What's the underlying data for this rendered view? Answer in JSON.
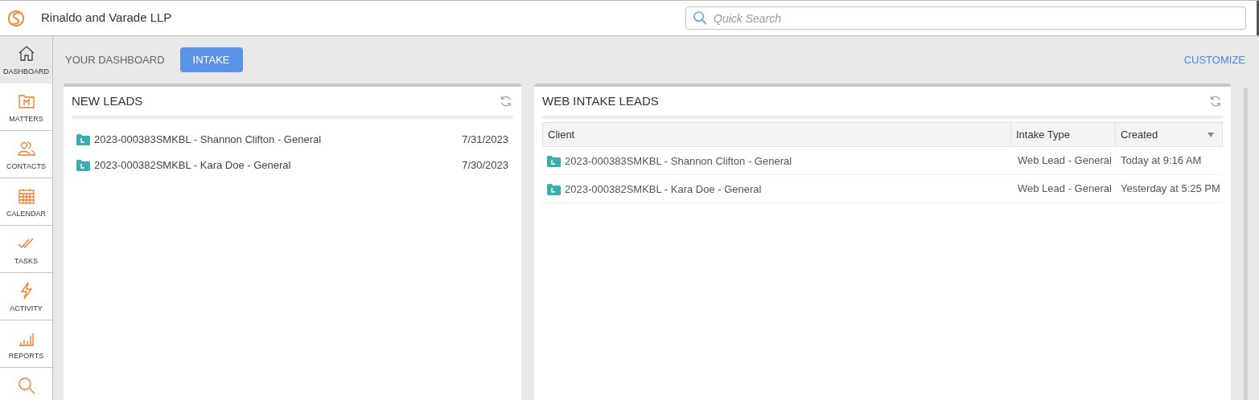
{
  "header": {
    "title": "Rinaldo and Varade LLP",
    "search": {
      "placeholder": "Quick Search"
    }
  },
  "sidebar": {
    "items": [
      {
        "kind": "dashboard",
        "label": "DASHBOARD",
        "selected": true
      },
      {
        "kind": "matters",
        "label": "MATTERS",
        "selected": false
      },
      {
        "kind": "contacts",
        "label": "CONTACTS",
        "selected": false
      },
      {
        "kind": "calendar",
        "label": "CALENDAR",
        "selected": false
      },
      {
        "kind": "tasks",
        "label": "TASKS",
        "selected": false
      },
      {
        "kind": "activity",
        "label": "ACTIVITY",
        "selected": false
      },
      {
        "kind": "reports",
        "label": "REPORTS",
        "selected": false
      },
      {
        "kind": "search",
        "selected": false
      }
    ]
  },
  "tabs": [
    {
      "label": "YOUR DASHBOARD",
      "selected": false
    },
    {
      "label": "INTAKE",
      "selected": true
    }
  ],
  "customize": "CUSTOMIZE",
  "new_leads": {
    "title": "NEW LEADS",
    "rows": [
      {
        "name": "2023-000383SMKBL - Shannon Clifton - General",
        "date": "7/31/2023"
      },
      {
        "name": "2023-000382SMKBL - Kara Doe - General",
        "date": "7/30/2023"
      }
    ]
  },
  "web_intake_leads": {
    "title": "WEB INTAKE LEADS",
    "table": {
      "columns": [
        "Client",
        "Intake Type",
        "Created"
      ],
      "rows": [
        {
          "client": "2023-000383SMKBL - Shannon Clifton - General",
          "intake_type": "Web Lead - General",
          "created": "Today at 9:16 AM"
        },
        {
          "client": "2023-000382SMKBL - Kara Doe - General",
          "intake_type": "Web Lead - General",
          "created": "Yesterday at 5:25 PM"
        }
      ]
    }
  }
}
